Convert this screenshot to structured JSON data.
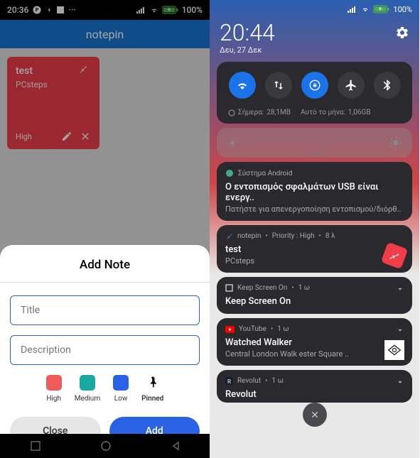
{
  "left": {
    "status": {
      "time": "20:36",
      "battery": "100%"
    },
    "header": {
      "title": "notepin"
    },
    "card": {
      "title": "test",
      "subtitle": "PCsteps",
      "priority": "High"
    },
    "sheet": {
      "title": "Add Note",
      "title_placeholder": "Title",
      "desc_placeholder": "Description",
      "priorities": {
        "high": "High",
        "medium": "Medium",
        "low": "Low",
        "pinned": "Pinned"
      },
      "close": "Close",
      "add": "Add"
    }
  },
  "right": {
    "status": {
      "battery": "100%"
    },
    "header": {
      "time": "20:44",
      "date": "Δευ, 27 Δεκ"
    },
    "qs": {
      "today_label": "Σήμερα:",
      "today_value": "28,1MB",
      "month_label": "Αυτό το μήνα:",
      "month_value": "1,06GB"
    },
    "notifs": {
      "android": {
        "app": "Σύστημα Android",
        "title": "Ο εντοπισμός σφαλμάτων USB είναι ενεργ..",
        "text": "Πατήστε για απενεργοποίηση εντοπισμού/διόρθ.."
      },
      "notepin": {
        "app": "notepin",
        "meta": "Priority : High",
        "age": "8 λ",
        "title": "test",
        "text": "PCsteps"
      },
      "keepscreen": {
        "app": "Keep Screen On",
        "age": "1 ω",
        "title": "Keep Screen On"
      },
      "youtube": {
        "app": "YouTube",
        "age": "1 ω",
        "title": "Watched Walker",
        "text": "Central London Walk        ester Square .."
      },
      "revolut": {
        "app": "Revolut",
        "age": "1 ω"
      }
    }
  }
}
